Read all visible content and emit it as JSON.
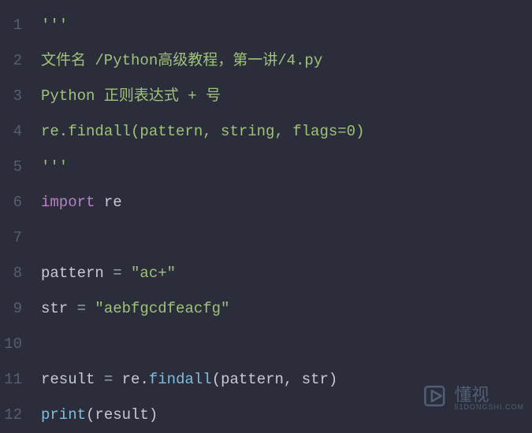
{
  "editor": {
    "lineNumbers": [
      "1",
      "2",
      "3",
      "4",
      "5",
      "6",
      "7",
      "8",
      "9",
      "10",
      "11",
      "12"
    ],
    "lines": [
      [
        {
          "t": "'''",
          "c": "str"
        }
      ],
      [
        {
          "t": "文件名 /Python高级教程，第一讲/4.py",
          "c": "str"
        }
      ],
      [
        {
          "t": "Python 正则表达式 + 号",
          "c": "str"
        }
      ],
      [
        {
          "t": "re.findall(pattern, string, flags=0)",
          "c": "str"
        }
      ],
      [
        {
          "t": "'''",
          "c": "str"
        }
      ],
      [
        {
          "t": "import",
          "c": "keyword"
        },
        {
          "t": " ",
          "c": "ident"
        },
        {
          "t": "re",
          "c": "ident"
        }
      ],
      [],
      [
        {
          "t": "pattern ",
          "c": "ident"
        },
        {
          "t": "=",
          "c": "op"
        },
        {
          "t": " ",
          "c": "ident"
        },
        {
          "t": "\"ac+\"",
          "c": "str"
        }
      ],
      [
        {
          "t": "str ",
          "c": "ident"
        },
        {
          "t": "=",
          "c": "op"
        },
        {
          "t": " ",
          "c": "ident"
        },
        {
          "t": "\"aebfgcdfeacfg\"",
          "c": "str"
        }
      ],
      [],
      [
        {
          "t": "result ",
          "c": "ident"
        },
        {
          "t": "=",
          "c": "op"
        },
        {
          "t": " re",
          "c": "ident"
        },
        {
          "t": ".",
          "c": "punc"
        },
        {
          "t": "findall",
          "c": "func"
        },
        {
          "t": "(pattern, str)",
          "c": "ident"
        }
      ],
      [
        {
          "t": "print",
          "c": "func"
        },
        {
          "t": "(result)",
          "c": "ident"
        }
      ]
    ]
  },
  "watermark": {
    "text": "懂视",
    "sub": "51DONGSHI.COM"
  }
}
